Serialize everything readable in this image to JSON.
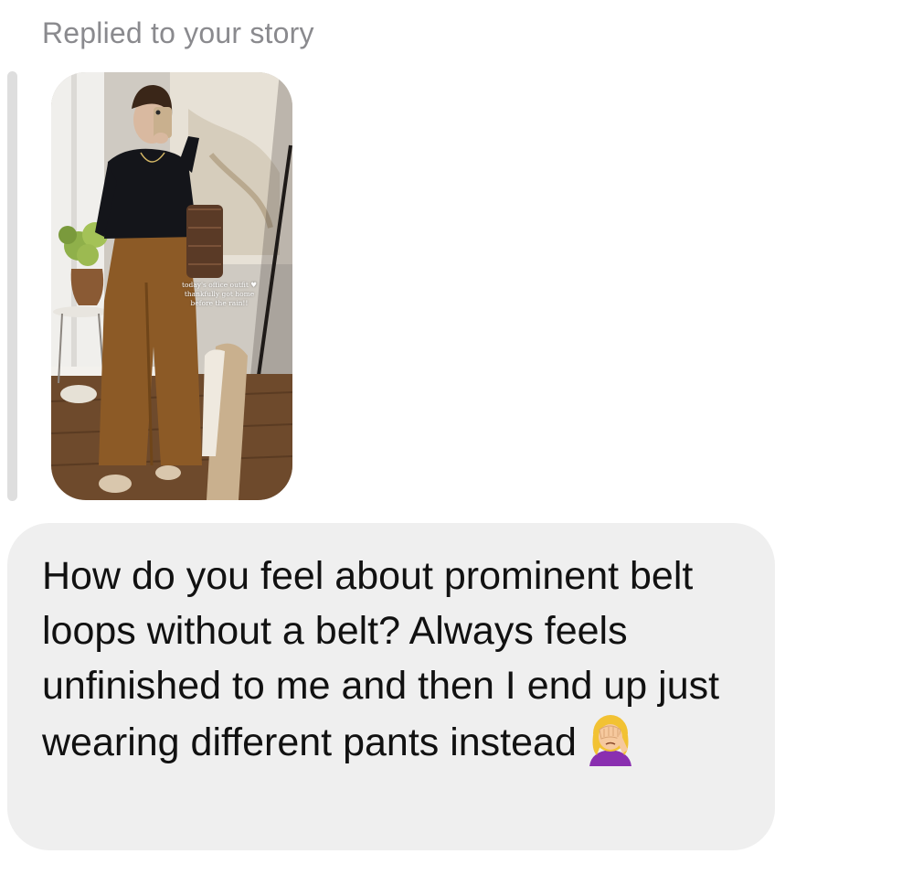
{
  "reply_header": "Replied to your story",
  "story": {
    "caption_lines": [
      "today's office outfit ♥",
      "thankfully got home",
      "before the rain!!"
    ]
  },
  "message": {
    "text": "How do you feel about prominent belt loops without a belt? Always feels unfinished to me and then I end up just wearing different pants instead",
    "emoji": "woman-facepalming-emoji"
  },
  "colors": {
    "header_text": "#8a8a8e",
    "bubble_background": "#efefef",
    "reply_bar": "#dedede",
    "message_text": "#111111"
  }
}
